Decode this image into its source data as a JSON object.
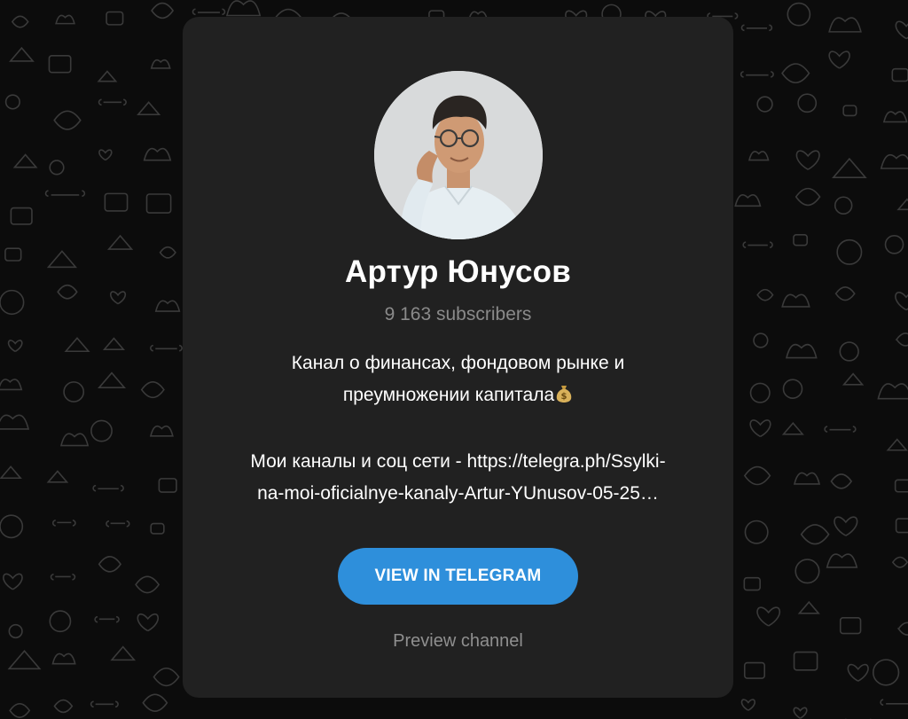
{
  "channel": {
    "name": "Артур Юнусов",
    "subscribers": "9 163 subscribers",
    "description_lines": [
      "Канал о финансах, фондовом рынке и",
      "преумножении капитала",
      "Мои каналы и соц сети - https://telegra.ph/Ssylki-",
      "na-moi-oficialnye-kanaly-Artur-YUnusov-05-25…"
    ],
    "description_emoji": "money-bag-icon"
  },
  "actions": {
    "view_button": "VIEW IN TELEGRAM",
    "preview_link": "Preview channel"
  },
  "colors": {
    "background": "#0c0c0c",
    "card": "#212121",
    "button": "#2e8fdb",
    "muted_text": "#8a8a8a",
    "text": "#ffffff"
  }
}
